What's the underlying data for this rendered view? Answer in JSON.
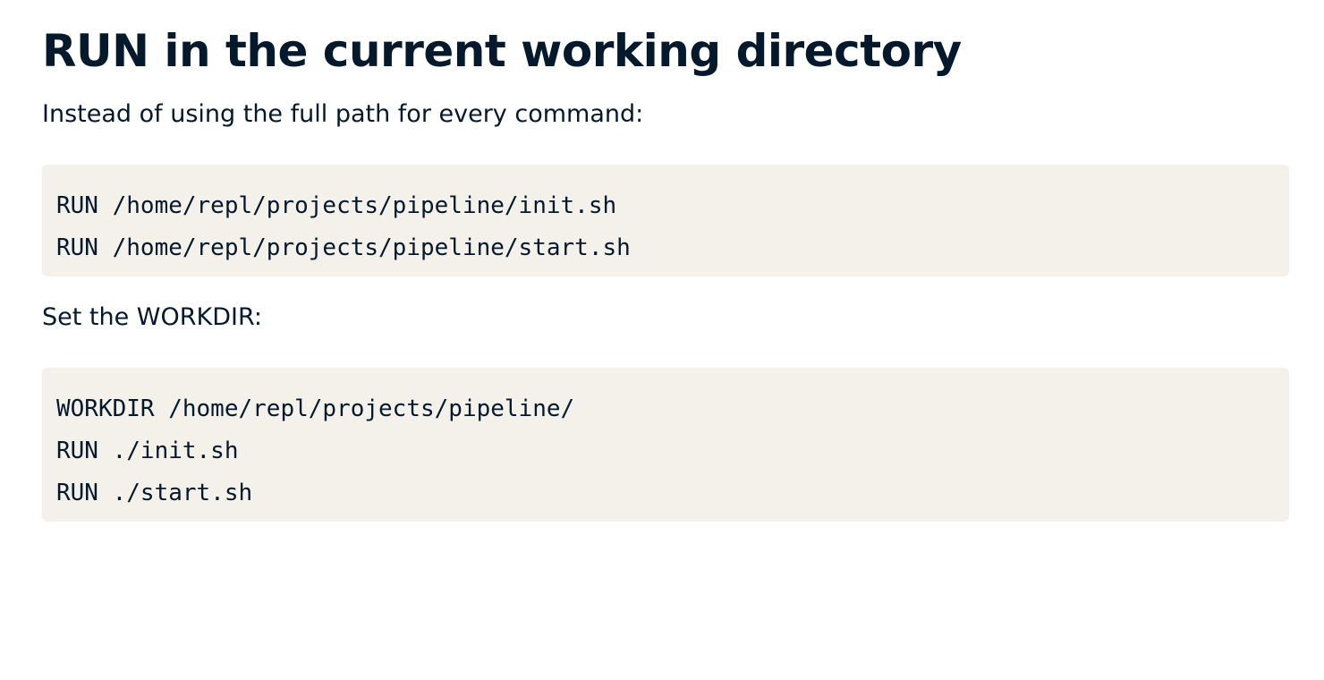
{
  "title": "RUN in the current working directory",
  "intro_text": "Instead of using the full path for every command:",
  "code_before": [
    "RUN /home/repl/projects/pipeline/init.sh",
    "RUN /home/repl/projects/pipeline/start.sh"
  ],
  "workdir_text": "Set the WORKDIR:",
  "code_after": [
    "WORKDIR /home/repl/projects/pipeline/",
    "RUN ./init.sh",
    "RUN ./start.sh"
  ],
  "colors": {
    "text": "#05192d",
    "code_background": "#f4f1eb"
  }
}
